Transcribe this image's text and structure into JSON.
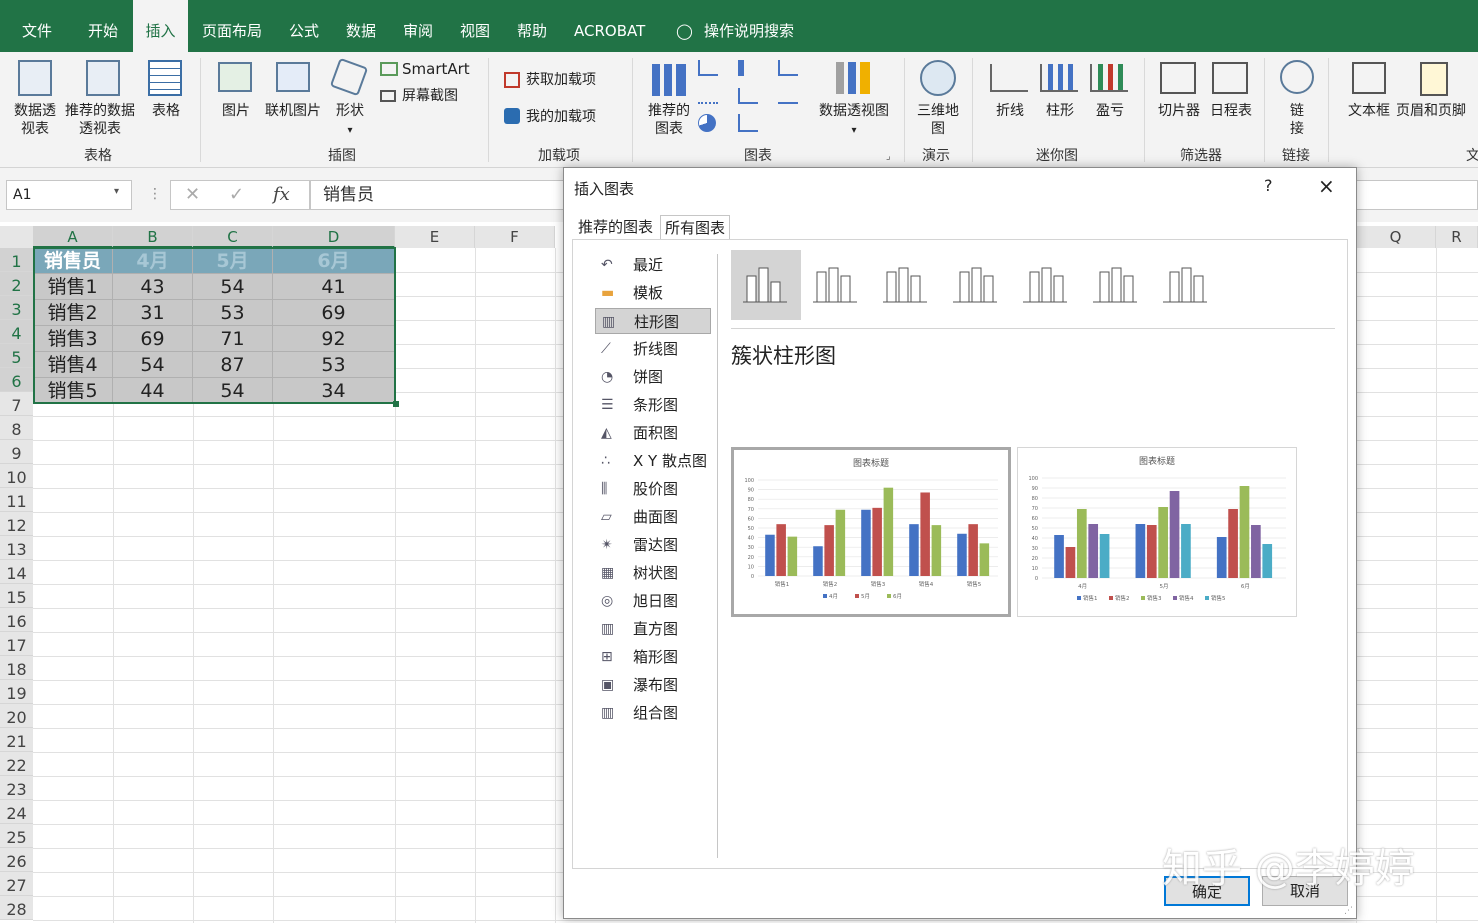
{
  "tabs": [
    "文件",
    "开始",
    "插入",
    "页面布局",
    "公式",
    "数据",
    "审阅",
    "视图",
    "帮助",
    "ACROBAT",
    "操作说明搜索"
  ],
  "ribbon": {
    "pivot": "数据透视表",
    "rec_pivot": "推荐的数据透视表",
    "table": "表格",
    "grp_table": "表格",
    "picture": "图片",
    "online_pic": "联机图片",
    "shapes": "形状",
    "smartart": "SmartArt",
    "screenshot": "屏幕截图",
    "grp_illus": "插图",
    "get_addins": "获取加载项",
    "my_addins": "我的加载项",
    "grp_addins": "加载项",
    "rec_charts": "推荐的图表",
    "pivot_chart": "数据透视图",
    "grp_charts": "图表",
    "map3d": "三维地图",
    "grp_tours": "演示",
    "spark_line": "折线",
    "spark_col": "柱形",
    "spark_wl": "盈亏",
    "grp_spark": "迷你图",
    "slicer": "切片器",
    "timeline": "日程表",
    "grp_filter": "筛选器",
    "link": "链接",
    "grp_links": "链接",
    "textbox": "文本框",
    "header_footer": "页眉和页脚",
    "grp_text": "文"
  },
  "formula_bar": {
    "name_box": "A1",
    "fx": "fx",
    "value": "销售员"
  },
  "columns": [
    "A",
    "B",
    "C",
    "D",
    "E",
    "F",
    "Q",
    "R"
  ],
  "rows": [
    "1",
    "2",
    "3",
    "4",
    "5",
    "6",
    "7",
    "8",
    "9",
    "10",
    "11",
    "12",
    "13",
    "14",
    "15",
    "16",
    "17",
    "18",
    "19",
    "20",
    "21",
    "22",
    "23",
    "24",
    "25",
    "26",
    "27",
    "28"
  ],
  "table": {
    "header": [
      "销售员",
      "4月",
      "5月",
      "6月"
    ],
    "rows": [
      [
        "销售1",
        "43",
        "54",
        "41"
      ],
      [
        "销售2",
        "31",
        "53",
        "69"
      ],
      [
        "销售3",
        "69",
        "71",
        "92"
      ],
      [
        "销售4",
        "54",
        "87",
        "53"
      ],
      [
        "销售5",
        "44",
        "54",
        "34"
      ]
    ]
  },
  "dialog": {
    "title": "插入图表",
    "help": "?",
    "close": "×",
    "tabs": [
      "推荐的图表",
      "所有图表"
    ],
    "chart_types": [
      "最近",
      "模板",
      "柱形图",
      "折线图",
      "饼图",
      "条形图",
      "面积图",
      "X Y 散点图",
      "股价图",
      "曲面图",
      "雷达图",
      "树状图",
      "旭日图",
      "直方图",
      "箱形图",
      "瀑布图",
      "组合图"
    ],
    "selected_type": "柱形图",
    "subtype_title": "簇状柱形图",
    "ok": "确定",
    "cancel": "取消"
  },
  "preview1": {
    "title": "图表标题",
    "categories": [
      "销售1",
      "销售2",
      "销售3",
      "销售4",
      "销售5"
    ],
    "series": [
      {
        "name": "4月",
        "color": "#4472c4",
        "values": [
          43,
          31,
          69,
          54,
          44
        ]
      },
      {
        "name": "5月",
        "color": "#c0504d",
        "values": [
          54,
          53,
          71,
          87,
          54
        ]
      },
      {
        "name": "6月",
        "color": "#9bbb59",
        "values": [
          41,
          69,
          92,
          53,
          34
        ]
      }
    ],
    "ylim": [
      0,
      100
    ]
  },
  "preview2": {
    "title": "图表标题",
    "categories": [
      "4月",
      "5月",
      "6月"
    ],
    "series": [
      {
        "name": "销售1",
        "color": "#4472c4",
        "values": [
          43,
          54,
          41
        ]
      },
      {
        "name": "销售2",
        "color": "#c0504d",
        "values": [
          31,
          53,
          69
        ]
      },
      {
        "name": "销售3",
        "color": "#9bbb59",
        "values": [
          69,
          71,
          92
        ]
      },
      {
        "name": "销售4",
        "color": "#8064a2",
        "values": [
          54,
          87,
          53
        ]
      },
      {
        "name": "销售5",
        "color": "#4bacc6",
        "values": [
          44,
          54,
          34
        ]
      }
    ],
    "ylim": [
      0,
      100
    ]
  },
  "watermark": "知乎 @李婷婷"
}
